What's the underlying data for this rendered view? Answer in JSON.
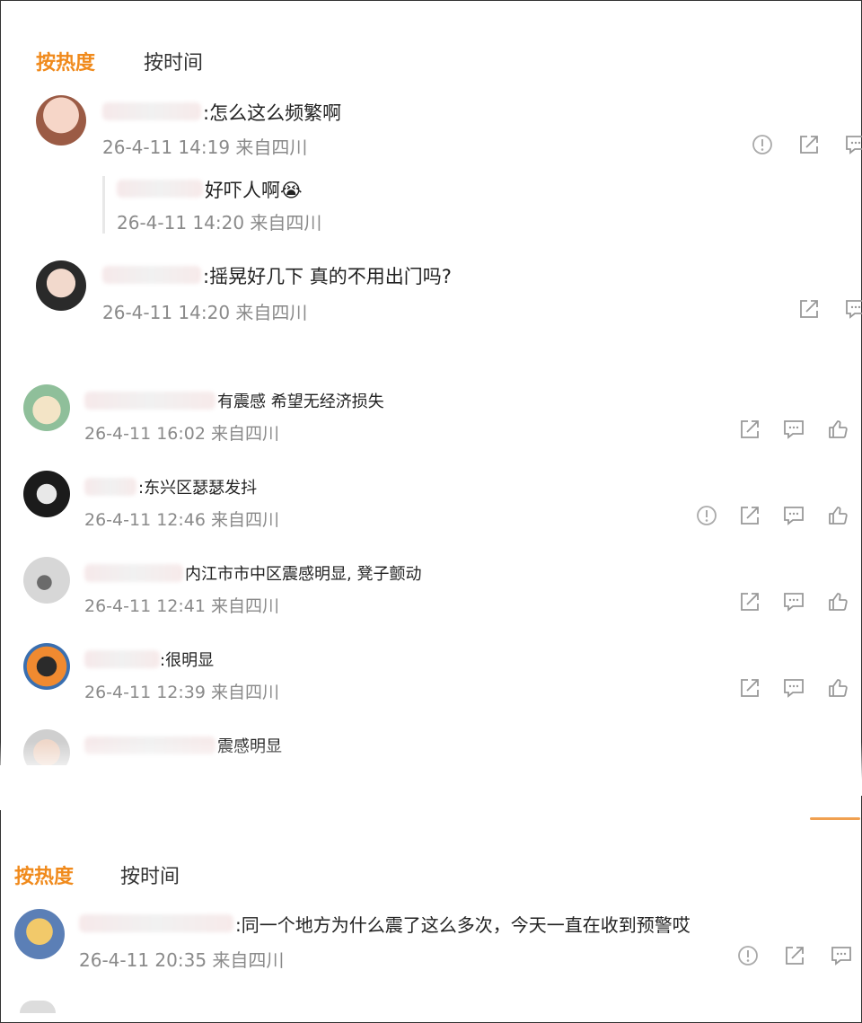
{
  "panel1": {
    "tab_hot": "按热度",
    "tab_time": "按时间",
    "comments": [
      {
        "text": ":怎么这么频繁啊",
        "meta": "26-4-11 14:19 来自四川"
      },
      {
        "text": "好吓人啊😭",
        "meta": "26-4-11 14:20 来自四川"
      },
      {
        "text": ":摇晃好几下 真的不用出门吗?",
        "meta": "26-4-11 14:20 来自四川"
      }
    ]
  },
  "panel2": {
    "comments": [
      {
        "text": "有震感 希望无经济损失",
        "meta": "26-4-11 16:02 来自四川"
      },
      {
        "text": ":东兴区瑟瑟发抖",
        "meta": "26-4-11 12:46 来自四川"
      },
      {
        "text": "内江市市中区震感明显, 凳子颤动",
        "meta": "26-4-11 12:41 来自四川"
      },
      {
        "text": ":很明显",
        "meta": "26-4-11 12:39 来自四川"
      },
      {
        "text": "震感明显",
        "meta": ""
      }
    ]
  },
  "panel3": {
    "tab_hot": "按热度",
    "tab_time": "按时间",
    "comments": [
      {
        "text": ":同一个地方为什么震了这么多次，今天一直在收到预警哎",
        "meta": "26-4-11 20:35 来自四川"
      }
    ]
  },
  "colors": {
    "accent": "#f08a1c",
    "meta_gray": "#8a8a8a",
    "icon_gray": "#9a9a9a"
  }
}
